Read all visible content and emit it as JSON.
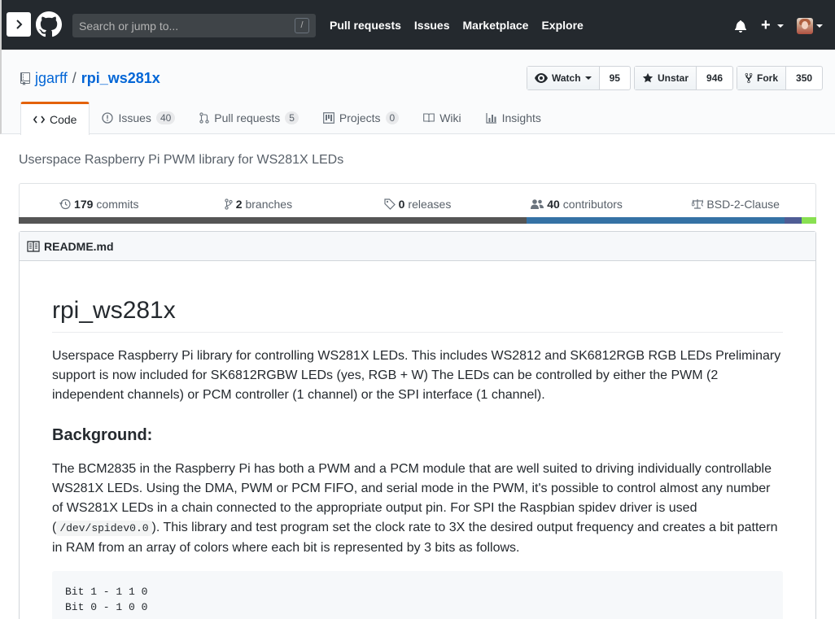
{
  "header": {
    "search_placeholder": "Search or jump to...",
    "slash_key": "/",
    "nav": [
      "Pull requests",
      "Issues",
      "Marketplace",
      "Explore"
    ],
    "icons": [
      "sidebar-toggle-icon",
      "github-logo-icon",
      "bell-icon",
      "plus-icon",
      "avatar"
    ]
  },
  "repo": {
    "owner": "jgarff",
    "separator": "/",
    "name": "rpi_ws281x",
    "watch": {
      "label": "Watch",
      "count": "95"
    },
    "star": {
      "label": "Unstar",
      "count": "946"
    },
    "fork": {
      "label": "Fork",
      "count": "350"
    }
  },
  "tabs": [
    {
      "label": "Code",
      "counter": "",
      "icon": "code-icon"
    },
    {
      "label": "Issues",
      "counter": "40",
      "icon": "issue-icon"
    },
    {
      "label": "Pull requests",
      "counter": "5",
      "icon": "pull-request-icon"
    },
    {
      "label": "Projects",
      "counter": "0",
      "icon": "project-icon"
    },
    {
      "label": "Wiki",
      "counter": "",
      "icon": "wiki-icon"
    },
    {
      "label": "Insights",
      "counter": "",
      "icon": "graph-icon"
    }
  ],
  "description": "Userspace Raspberry Pi PWM library for WS281X LEDs",
  "summary": {
    "commits": {
      "count": "179",
      "label": "commits"
    },
    "branches": {
      "count": "2",
      "label": "branches"
    },
    "releases": {
      "count": "0",
      "label": "releases"
    },
    "contributors": {
      "count": "40",
      "label": "contributors"
    },
    "license": "BSD-2-Clause"
  },
  "languages": [
    {
      "color": "#555555",
      "percent": 63.7
    },
    {
      "color": "#3572A5",
      "percent": 32.3
    },
    {
      "color": "#4F5D95",
      "percent": 2.2
    },
    {
      "color": "#89e051",
      "percent": 1.8
    }
  ],
  "readme": {
    "filename": "README.md",
    "title": "rpi_ws281x",
    "intro": "Userspace Raspberry Pi library for controlling WS281X LEDs. This includes WS2812 and SK6812RGB RGB LEDs Preliminary support is now included for SK6812RGBW LEDs (yes, RGB + W) The LEDs can be controlled by either the PWM (2 independent channels) or PCM controller (1 channel) or the SPI interface (1 channel).",
    "background_heading": "Background:",
    "background_text_1": "The BCM2835 in the Raspberry Pi has both a PWM and a PCM module that are well suited to driving individually controllable WS281X LEDs. Using the DMA, PWM or PCM FIFO, and serial mode in the PWM, it's possible to control almost any number of WS281X LEDs in a chain connected to the appropriate output pin. For SPI the Raspbian spidev driver is used (",
    "background_code": "/dev/spidev0.0",
    "background_text_2": "). This library and test program set the clock rate to 3X the desired output frequency and creates a bit pattern in RAM from an array of colors where each bit is represented by 3 bits as follows.",
    "code_block": [
      "Bit 1 - 1 1 0",
      "Bit 0 - 1 0 0"
    ]
  }
}
